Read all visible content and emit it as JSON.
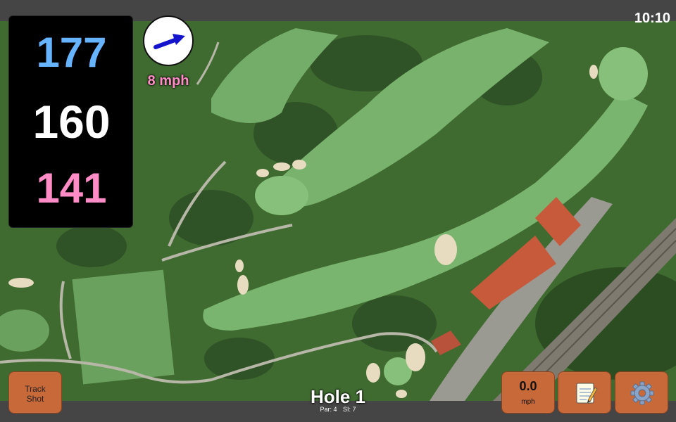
{
  "status_bar": {
    "time": "10:10"
  },
  "yardages": {
    "back": "177",
    "middle": "160",
    "front": "141"
  },
  "wind": {
    "speed_label": "8 mph",
    "direction_icon": "arrow-right-icon"
  },
  "hole": {
    "title": "Hole 1",
    "par_label": "Par: 4",
    "si_label": "SI: 7"
  },
  "buttons": {
    "track_shot_line1": "Track",
    "track_shot_line2": "Shot",
    "speed_value": "0.0",
    "speed_unit": "mph",
    "notes_icon": "notepad-icon",
    "settings_icon": "gear-icon"
  },
  "colors": {
    "back_yardage": "#66b3ff",
    "middle_yardage": "#ffffff",
    "front_yardage": "#ff8cc6",
    "button_orange": "#c8693a",
    "wind_arrow": "#1414cc"
  }
}
